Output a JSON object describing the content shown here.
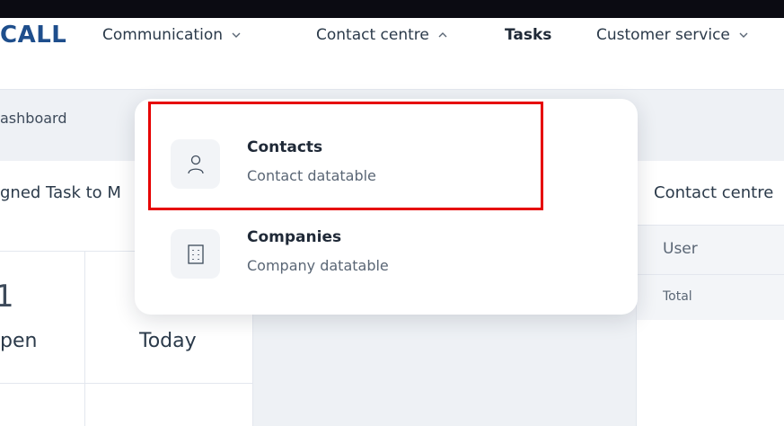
{
  "brand": {
    "name": "CALL"
  },
  "nav": {
    "items": [
      {
        "label": "Communication",
        "chevron": "chevron-down"
      },
      {
        "label": "Contact centre",
        "chevron": "chevron-up"
      },
      {
        "label": "Tasks"
      },
      {
        "label": "Customer service",
        "chevron": "chevron-down"
      }
    ]
  },
  "breadcrumb": {
    "label": "ashboard"
  },
  "left_card": {
    "title": "gned Task to M",
    "stats": [
      {
        "value": "1",
        "label": "pen"
      },
      {
        "value": "",
        "label": "Today"
      }
    ]
  },
  "right_card": {
    "title": "Contact centre",
    "table": {
      "header": "User",
      "total_label": "Total"
    }
  },
  "dropdown": {
    "items": [
      {
        "title": "Contacts",
        "subtitle": "Contact datatable",
        "icon": "user-icon"
      },
      {
        "title": "Companies",
        "subtitle": "Company datatable",
        "icon": "building-icon"
      }
    ]
  },
  "colors": {
    "brand": "#1e4e8c",
    "highlight": "#e60000",
    "topstrip": "#0b0b12"
  }
}
